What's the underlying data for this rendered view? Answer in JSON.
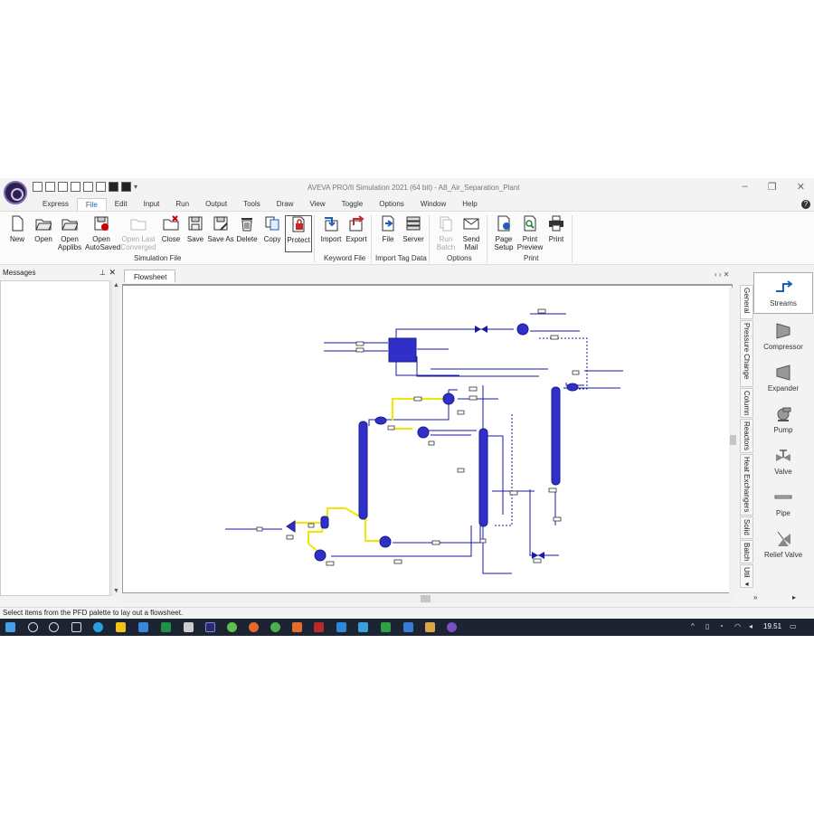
{
  "window": {
    "title": "AVEVA PRO/II Simulation 2021 (64 bit) - A8_Air_Separation_Plant",
    "minimize_glyph": "–",
    "restore_glyph": "❐",
    "close_glyph": "✕"
  },
  "menu": {
    "items": [
      "Express",
      "File",
      "Edit",
      "Input",
      "Run",
      "Output",
      "Tools",
      "Draw",
      "View",
      "Toggle",
      "Options",
      "Window",
      "Help"
    ],
    "active": "File",
    "help_glyph": "?"
  },
  "ribbon": {
    "buttons": [
      {
        "label": "New",
        "icon": "new-file-icon"
      },
      {
        "label": "Open",
        "icon": "open-folder-icon"
      },
      {
        "label": "Open Applibs",
        "icon": "open-applibs-icon"
      },
      {
        "label": "Open AutoSaved",
        "icon": "open-autosaved-icon"
      },
      {
        "label": "Open Last Converged",
        "icon": "open-last-converged-icon",
        "disabled": true
      },
      {
        "label": "Close",
        "icon": "close-folder-icon"
      },
      {
        "label": "Save",
        "icon": "save-icon"
      },
      {
        "label": "Save As",
        "icon": "save-as-icon"
      },
      {
        "label": "Delete",
        "icon": "delete-icon"
      },
      {
        "label": "Copy",
        "icon": "copy-icon"
      },
      {
        "label": "Protect",
        "icon": "protect-icon"
      },
      {
        "label": "Import",
        "icon": "import-icon"
      },
      {
        "label": "Export",
        "icon": "export-icon"
      },
      {
        "label": "File",
        "icon": "import-file-icon"
      },
      {
        "label": "Server",
        "icon": "server-icon"
      },
      {
        "label": "Run Batch",
        "icon": "run-batch-icon",
        "disabled": true
      },
      {
        "label": "Send Mail",
        "icon": "mail-icon"
      },
      {
        "label": "Page Setup",
        "icon": "page-setup-icon"
      },
      {
        "label": "Print Preview",
        "icon": "print-preview-icon"
      },
      {
        "label": "Print",
        "icon": "printer-icon"
      }
    ],
    "groups": [
      "Simulation File",
      "Keyword File",
      "Import Tag Data",
      "Options",
      "Print"
    ]
  },
  "messages_panel": {
    "title": "Messages",
    "pin_glyph": "⊥",
    "close_glyph": "✕"
  },
  "flowsheet": {
    "tab": "Flowsheet",
    "nav_glyphs": "‹ › ✕"
  },
  "palette_tabs": [
    "General",
    "Pressure Change",
    "Column",
    "Reactors",
    "Heat Exchangers",
    "Solid",
    "Batch",
    "Util ◂"
  ],
  "palette": {
    "items": [
      {
        "label": "Streams",
        "icon": "streams-icon"
      },
      {
        "label": "Compressor",
        "icon": "compressor-icon"
      },
      {
        "label": "Expander",
        "icon": "expander-icon"
      },
      {
        "label": "Pump",
        "icon": "pump-icon"
      },
      {
        "label": "Valve",
        "icon": "valve-icon"
      },
      {
        "label": "Pipe",
        "icon": "pipe-icon"
      },
      {
        "label": "Relief Valve",
        "icon": "relief-valve-icon"
      }
    ],
    "nav_left": "»",
    "nav_right": "▸"
  },
  "status_bar": {
    "text": "Select items from the PFD palette to lay out a flowsheet."
  },
  "taskbar": {
    "time": "19.51"
  },
  "colors": {
    "equipment": "#2b2bd0",
    "stream": "#1a1aaa",
    "highlight_stream": "#f3e600",
    "selected_menu": "#1c5fb5",
    "taskbar": "#1c2433"
  }
}
